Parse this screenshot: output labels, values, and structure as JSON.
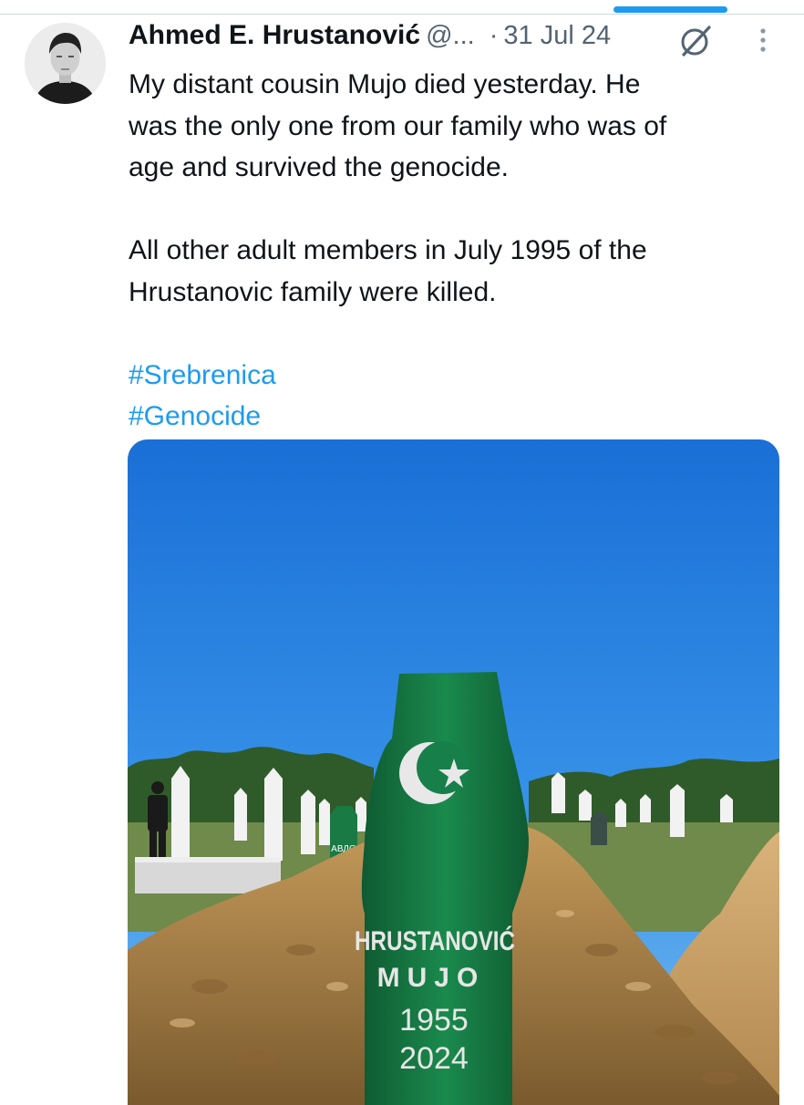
{
  "tweet": {
    "author_name": "Ahmed E. Hrustanović",
    "author_handle": "@...",
    "separator": "·",
    "date": "31 Jul 24",
    "text_line_1": "My distant cousin Mujo died yesterday. He",
    "text_line_2": "was the only one from our family who was of",
    "text_line_3": "age and survived the genocide.",
    "text_line_4": "All other adult members in July 1995 of the",
    "text_line_5": "Hrustanovic family were killed.",
    "hashtags": [
      "#Srebrenica",
      "#Genocide"
    ]
  },
  "media": {
    "gravestone_name": "HRUSTANOVIĆ",
    "gravestone_first_name": "MUJO",
    "birth_year": "1955",
    "death_year": "2024",
    "small_marker_text": "АВДО"
  },
  "icons": {
    "grok": "grok-icon",
    "more": "more-options-icon"
  },
  "colors": {
    "accent": "#1d9bf0",
    "secondary_text": "#536471",
    "sky": "#2a86e2",
    "grave_green": "#177a44"
  }
}
